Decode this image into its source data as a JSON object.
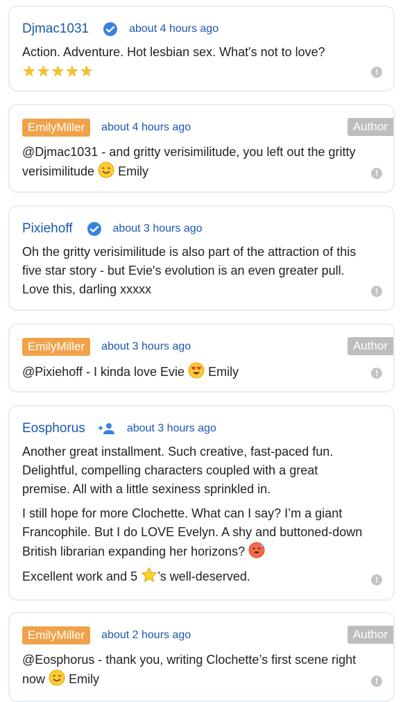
{
  "comments": [
    {
      "user": "Djmac1031",
      "time": "about 4 hours ago",
      "paragraphs": [
        "Action. Adventure. Hot lesbian sex. What's not to love?"
      ],
      "stars": "★★★★★"
    },
    {
      "user": "EmilyMiller",
      "time": "about 4 hours ago",
      "badge": "Author",
      "text_before": "@Djmac1031 - and gritty verisimilitude, you left out the gritty verisimilitude",
      "text_after": "Emily"
    },
    {
      "user": "Pixiehoff",
      "time": "about 3 hours ago",
      "paragraphs": [
        "Oh the gritty verisimilitude is also part of the attraction of this five star story - but Evie's evolution is an even greater pull. Love this, darling xxxxx"
      ]
    },
    {
      "user": "EmilyMiller",
      "time": "about 3 hours ago",
      "badge": "Author",
      "text_before": "@Pixiehoff - I kinda love Evie",
      "text_after": "Emily"
    },
    {
      "user": "Eosphorus",
      "time": "about 3 hours ago",
      "paragraphs": [
        "Another great installment. Such creative, fast-paced fun. Delightful, compelling characters coupled with a great premise. All with a little sexiness sprinkled in.",
        "I still hope for more Clochette. What can I say? I’m a giant Francophile. But I do LOVE Evelyn. A shy and buttoned-down British librarian expanding her horizons?"
      ],
      "p3_before": "Excellent work and 5",
      "p3_after": "’s well-deserved."
    },
    {
      "user": "EmilyMiller",
      "time": "about 2 hours ago",
      "badge": "Author",
      "text_before": "@Eosphorus - thank you, writing Clochette’s first scene right now",
      "text_after": "Emily"
    }
  ],
  "flag_symbol": "!",
  "colors": {
    "link": "#1a56b0",
    "author_name_bg": "#f0a24a",
    "author_badge_bg": "#bdbdbd",
    "verified": "#3b82e0"
  }
}
